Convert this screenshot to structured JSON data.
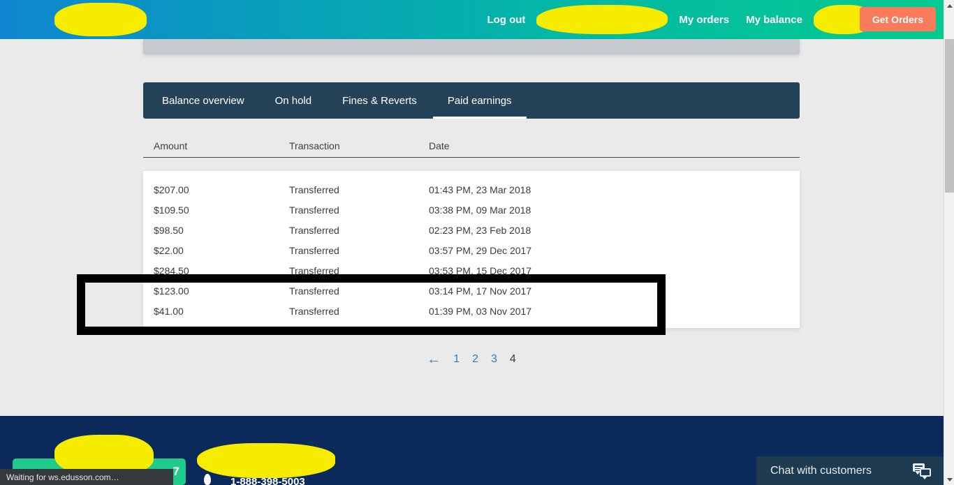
{
  "header": {
    "brand_redacted": "",
    "nav": [
      {
        "label": "Log out",
        "type": "link"
      },
      {
        "label": "",
        "type": "redaction",
        "size": "wide"
      },
      {
        "label": "My orders",
        "type": "link"
      },
      {
        "label": "My balance",
        "type": "link"
      },
      {
        "label": "",
        "type": "redaction",
        "size": "narrow"
      }
    ],
    "cta_label": "Get Orders",
    "cta_color": "#fa7a5c",
    "gradient_from": "#0e86d0",
    "gradient_to": "#03cb8f"
  },
  "tabs": [
    {
      "label": "Balance overview",
      "active": false
    },
    {
      "label": "On hold",
      "active": false
    },
    {
      "label": "Fines & Reverts",
      "active": false
    },
    {
      "label": "Paid earnings",
      "active": true
    }
  ],
  "table": {
    "columns": [
      "Amount",
      "Transaction",
      "Date"
    ],
    "rows": [
      {
        "amount": "$207.00",
        "transaction": "Transferred",
        "date": "01:43 PM, 23 Mar 2018"
      },
      {
        "amount": "$109.50",
        "transaction": "Transferred",
        "date": "03:38 PM, 09 Mar 2018"
      },
      {
        "amount": "$98.50",
        "transaction": "Transferred",
        "date": "02:23 PM, 23 Feb 2018"
      },
      {
        "amount": "$22.00",
        "transaction": "Transferred",
        "date": "03:57 PM, 29 Dec 2017"
      },
      {
        "amount": "$284.50",
        "transaction": "Transferred",
        "date": "03:53 PM, 15 Dec 2017"
      },
      {
        "amount": "$123.00",
        "transaction": "Transferred",
        "date": "03:14 PM, 17 Nov 2017"
      },
      {
        "amount": "$41.00",
        "transaction": "Transferred",
        "date": "01:39 PM, 03 Nov 2017"
      }
    ]
  },
  "pagination": {
    "prev_icon": "←",
    "pages": [
      {
        "label": "1",
        "current": false
      },
      {
        "label": "2",
        "current": false
      },
      {
        "label": "3",
        "current": false
      },
      {
        "label": "4",
        "current": true
      }
    ],
    "link_color": "#2a7fc1",
    "current_color": "#3b3b3b"
  },
  "footer": {
    "green_badge_number": "7",
    "phone": "1-888-398-5003",
    "background": "#0b2a5b"
  },
  "chat": {
    "title": "Chat with customers",
    "icon": "chat-bubbles-icon"
  },
  "status_bar": {
    "text": "Waiting for ws.edusson.com…"
  },
  "annotation": {
    "shape": "black-rectangle-outline"
  }
}
